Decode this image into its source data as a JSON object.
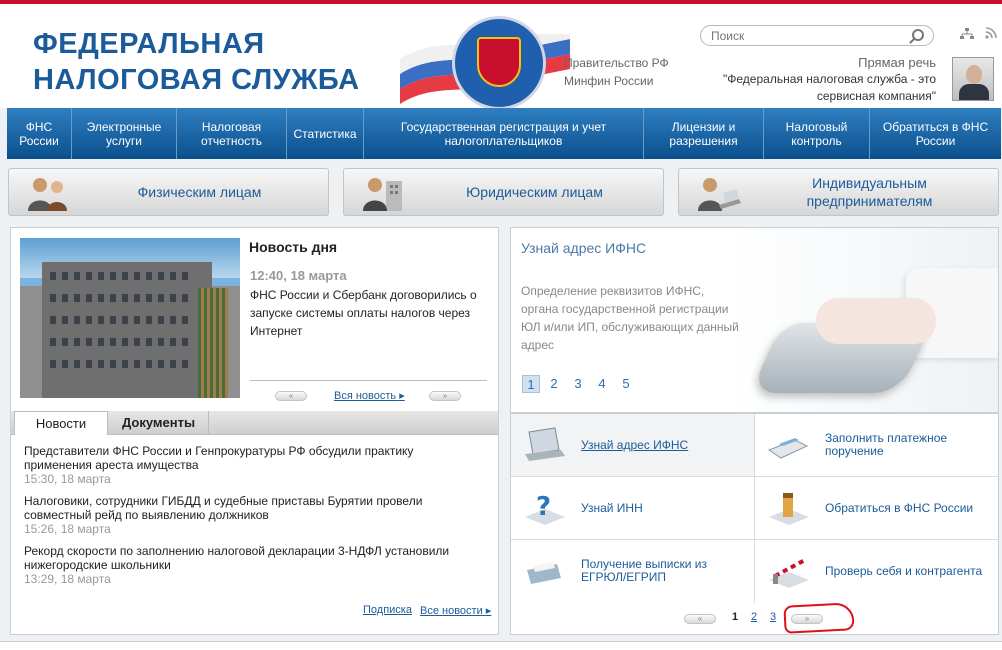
{
  "header": {
    "brand_line1": "ФЕДЕРАЛЬНАЯ",
    "brand_line2": "НАЛОГОВАЯ СЛУЖБА",
    "gov_link1": "Правительство РФ",
    "gov_link2": "Минфин России",
    "search_placeholder": "Поиск",
    "direct_label": "Прямая речь",
    "direct_quote": "\"Федеральная налоговая служба - это сервисная компания\""
  },
  "nav": [
    {
      "label": "ФНС России"
    },
    {
      "label": "Электронные услуги"
    },
    {
      "label": "Налоговая отчетность"
    },
    {
      "label": "Статистика"
    },
    {
      "label": "Государственная регистрация и учет налогоплательщиков"
    },
    {
      "label": "Лицензии и разрешения"
    },
    {
      "label": "Налоговый контроль"
    },
    {
      "label": "Обратиться в ФНС России"
    }
  ],
  "categories": {
    "individuals": "Физическим лицам",
    "legal": "Юридическим лицам",
    "entrepreneurs": "Индивидуальным предпринимателям"
  },
  "news_day": {
    "title": "Новость дня",
    "time": "12:40, 18 марта",
    "text": "ФНС России и Сбербанк договорились о запуске системы оплаты налогов через Интернет",
    "prev": "«",
    "next": "»",
    "all_link": "Вся новость"
  },
  "tabs": {
    "news": "Новости",
    "docs": "Документы"
  },
  "news": [
    {
      "text": "Представители ФНС России и Генпрокуратуры РФ обсудили практику применения ареста имущества",
      "time": "15:30, 18 марта"
    },
    {
      "text": "Налоговики, сотрудники ГИБДД и судебные приставы Бурятии провели совместный рейд по выявлению должников",
      "time": "15:26, 18 марта"
    },
    {
      "text": "Рекорд скорости по заполнению налоговой декларации 3-НДФЛ установили нижегородские школьники",
      "time": "13:29, 18 марта"
    }
  ],
  "news_footer": {
    "subscribe": "Подписка",
    "all": "Все новости"
  },
  "promo": {
    "title": "Узнай адрес ИФНС",
    "desc": "Определение реквизитов ИФНС, органа государственной регистрации ЮЛ и/или ИП, обслуживающих данный адрес",
    "pages": [
      "1",
      "2",
      "3",
      "4",
      "5"
    ]
  },
  "services": [
    {
      "label": "Узнай адрес ИФНС"
    },
    {
      "label": "Заполнить платежное поручение"
    },
    {
      "label": "Узнай ИНН"
    },
    {
      "label": "Обратиться в ФНС России"
    },
    {
      "label": "Получение выписки из ЕГРЮЛ/ЕГРИП"
    },
    {
      "label": "Проверь себя и контрагента"
    }
  ],
  "services_pager": {
    "prev": "«",
    "p1": "1",
    "p2": "2",
    "p3": "3",
    "next": "»"
  },
  "colors": {
    "brand_blue": "#1c5b9a",
    "nav_blue": "#0b4f8e",
    "accent_red": "#c8102e",
    "annotation_red": "#e0101a"
  }
}
